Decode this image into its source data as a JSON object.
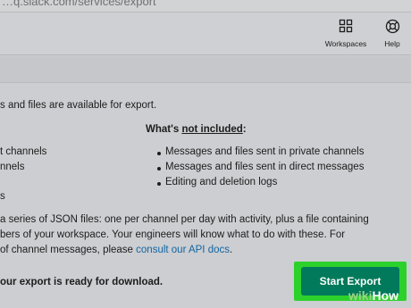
{
  "browser": {
    "url_fragment": "…q.slack.com/services/export"
  },
  "header": {
    "workspaces_label": "Workspaces",
    "help_label": "Help"
  },
  "main": {
    "intro": "s and files are available for export.",
    "not_included_prefix": "What's ",
    "not_included_underlined": "not included",
    "not_included_suffix": ":",
    "included_items": [
      "t channels",
      "nnels",
      "s"
    ],
    "not_included_items": [
      "Messages and files sent in private channels",
      "Messages and files sent in direct messages",
      "Editing and deletion logs"
    ],
    "paragraph": {
      "line1": "a series of JSON files: one per channel per day with activity, plus a file containing",
      "line2": "bers of your workspace. Your engineers will know what to do with these. For",
      "line3_prefix": "of channel messages, please ",
      "line3_link": "consult our API docs",
      "line3_suffix": "."
    },
    "ready_text": "our export is ready for download."
  },
  "actions": {
    "start_export_label": "Start Export"
  },
  "watermark": {
    "part1": "wiki",
    "part2": "How"
  },
  "colors": {
    "primary_button": "#007a5a",
    "highlight": "#2cd12c",
    "link": "#1264a3"
  }
}
